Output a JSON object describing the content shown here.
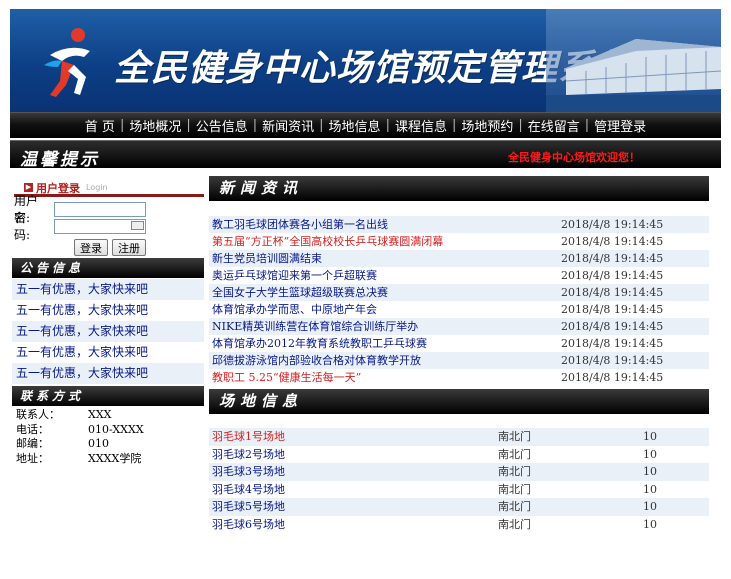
{
  "banner": {
    "title": "全民健身中心场馆预定管理系统"
  },
  "nav": {
    "items": [
      "首 页",
      "场地概况",
      "公告信息",
      "新闻资讯",
      "场地信息",
      "课程信息",
      "场地预约",
      "在线留言",
      "管理登录"
    ]
  },
  "notice_bar": {
    "title": "温馨提示",
    "message": "全民健身中心场馆欢迎您！"
  },
  "login": {
    "title": "用户登录",
    "subtitle": "Login",
    "username_label": "用户名:",
    "password_label": "密　码:",
    "login_button": "登录",
    "register_button": "注册"
  },
  "announcements": {
    "title": "公告信息",
    "items": [
      "五一有优惠，大家快来吧",
      "五一有优惠，大家快来吧",
      "五一有优惠，大家快来吧",
      "五一有优惠，大家快来吧",
      "五一有优惠，大家快来吧"
    ]
  },
  "contact": {
    "title": "联系方式",
    "rows": [
      {
        "k": "联系人：",
        "v": "XXX"
      },
      {
        "k": "电话：",
        "v": "010-XXXX"
      },
      {
        "k": "邮编：",
        "v": "010"
      },
      {
        "k": "地址：",
        "v": "XXXX学院"
      }
    ]
  },
  "news": {
    "title": "新闻资讯",
    "items": [
      {
        "text": "教工羽毛球团体赛各小组第一名出线",
        "date": "2018/4/8 19:14:45",
        "hot": false
      },
      {
        "text": "第五届“方正杯”全国高校校长乒乓球赛圆满闭幕",
        "date": "2018/4/8 19:14:45",
        "hot": true
      },
      {
        "text": "新生党员培训圆满结束",
        "date": "2018/4/8 19:14:45",
        "hot": false
      },
      {
        "text": "奥运乒乓球馆迎来第一个乒超联赛",
        "date": "2018/4/8 19:14:45",
        "hot": false
      },
      {
        "text": "全国女子大学生篮球超级联赛总决赛",
        "date": "2018/4/8 19:14:45",
        "hot": false
      },
      {
        "text": "体育馆承办学而思、中原地产年会",
        "date": "2018/4/8 19:14:45",
        "hot": false
      },
      {
        "text": "NIKE精英训练营在体育馆综合训练厅举办",
        "date": "2018/4/8 19:14:45",
        "hot": false
      },
      {
        "text": "体育馆承办2012年教育系统教职工乒乓球赛",
        "date": "2018/4/8 19:14:45",
        "hot": false
      },
      {
        "text": "邱德拔游泳馆内部验收合格对体育教学开放",
        "date": "2018/4/8 19:14:45",
        "hot": false
      },
      {
        "text": "教职工 5.25“健康生活每一天”",
        "date": "2018/4/8 19:14:45",
        "hot": true
      }
    ]
  },
  "venues": {
    "title": "场地信息",
    "rows": [
      {
        "name": "羽毛球1号场地",
        "gate": "南北门",
        "cap": "10",
        "hot": true
      },
      {
        "name": "羽毛球2号场地",
        "gate": "南北门",
        "cap": "10",
        "hot": false
      },
      {
        "name": "羽毛球3号场地",
        "gate": "南北门",
        "cap": "10",
        "hot": false
      },
      {
        "name": "羽毛球4号场地",
        "gate": "南北门",
        "cap": "10",
        "hot": false
      },
      {
        "name": "羽毛球5号场地",
        "gate": "南北门",
        "cap": "10",
        "hot": false
      },
      {
        "name": "羽毛球6号场地",
        "gate": "南北门",
        "cap": "10",
        "hot": false
      }
    ]
  }
}
